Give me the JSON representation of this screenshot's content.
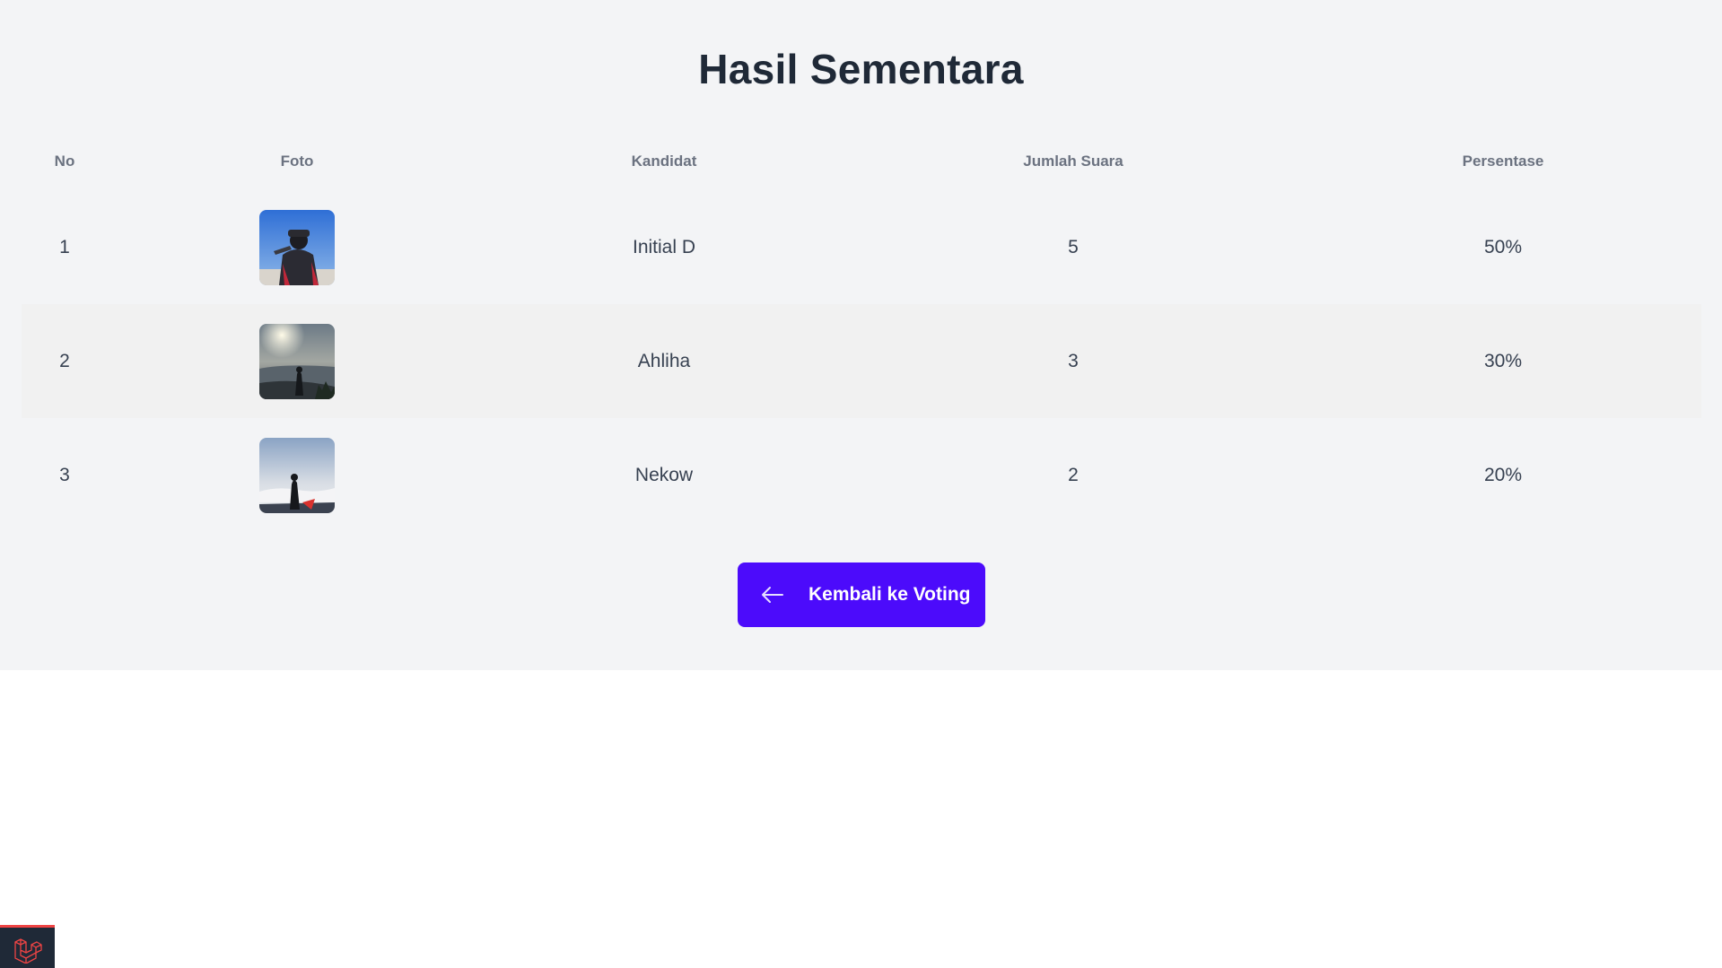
{
  "page": {
    "title": "Hasil Sementara"
  },
  "table": {
    "headers": {
      "no": "No",
      "photo": "Foto",
      "candidate": "Kandidat",
      "votes": "Jumlah Suara",
      "percentage": "Persentase"
    },
    "rows": [
      {
        "no": "1",
        "candidate": "Initial D",
        "votes": "5",
        "percentage": "50%",
        "photo_icon": "candidate-photo-hiker-blue-sky"
      },
      {
        "no": "2",
        "candidate": "Ahliha",
        "votes": "3",
        "percentage": "30%",
        "photo_icon": "candidate-photo-sunrise-silhouette"
      },
      {
        "no": "3",
        "candidate": "Nekow",
        "votes": "2",
        "percentage": "20%",
        "photo_icon": "candidate-photo-cloud-summit"
      }
    ]
  },
  "actions": {
    "back_label": "Kembali ke Voting",
    "back_icon": "arrow-left-icon"
  },
  "footer": {
    "badge_icon": "laravel-logo-icon"
  },
  "colors": {
    "page_bg": "#f3f4f6",
    "button_bg": "#4c0bfb",
    "title": "#1f2937",
    "header_text": "#6b7280",
    "stripe": "#f1f1f1"
  }
}
